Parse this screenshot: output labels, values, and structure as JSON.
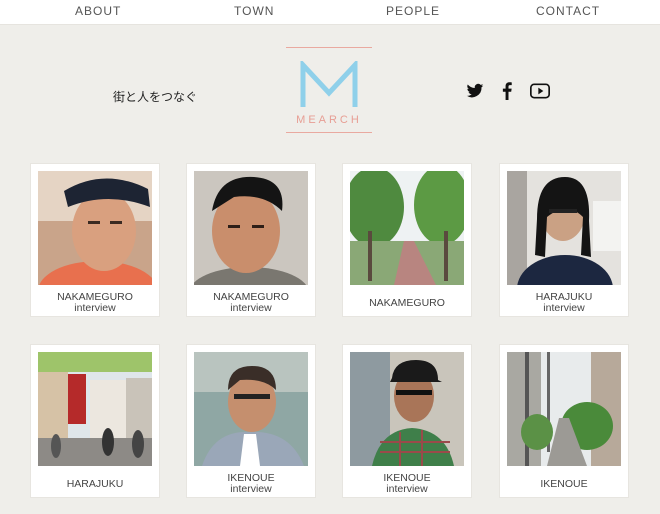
{
  "nav": [
    "ABOUT",
    "TOWN",
    "PEOPLE",
    "CONTACT"
  ],
  "tagline": "街と人をつなぐ",
  "logo": {
    "letter": "M",
    "word": "MEARCH"
  },
  "social": [
    "twitter-icon",
    "facebook-icon",
    "youtube-icon"
  ],
  "colors": {
    "background": "#efeeea",
    "logo_blue": "#8fd0ea",
    "logo_pink": "#e79e94"
  },
  "cards": [
    {
      "label": "NAKAMEGURO",
      "sub": "interview"
    },
    {
      "label": "NAKAMEGURO",
      "sub": "interview"
    },
    {
      "label": "NAKAMEGURO",
      "sub": ""
    },
    {
      "label": "HARAJUKU",
      "sub": "interview"
    },
    {
      "label": "HARAJUKU",
      "sub": ""
    },
    {
      "label": "IKENOUE",
      "sub": "interview"
    },
    {
      "label": "IKENOUE",
      "sub": "interview"
    },
    {
      "label": "IKENOUE",
      "sub": ""
    }
  ]
}
